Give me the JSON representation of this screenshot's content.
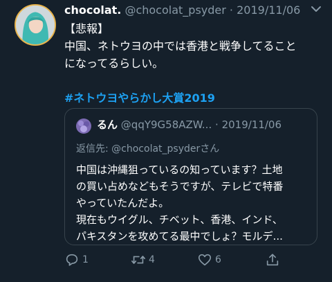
{
  "tweet": {
    "display_name": "chocolat.",
    "handle": "@chocolat_psyder",
    "separator": "·",
    "date": "2019/11/06",
    "lines": [
      "【悲報】",
      "中国、ネトウヨの中では香港と戦争してること",
      "になってるらしい。"
    ],
    "hashtag": "#ネトウヨやらかし大賞2019"
  },
  "quote": {
    "display_name": "るん",
    "handle": "@qqY9G58AZW...",
    "separator": "·",
    "date": "2019/11/06",
    "reply_prefix": "返信先: ",
    "reply_handle": "@chocolat_psyder",
    "reply_suffix": "さん",
    "lines": [
      "中国は沖縄狙っているの知っています？土地",
      "の買い占めなどもそうですが、テレビで特番",
      "やっていたんだよ。",
      "現在もウイグル、チベット、香港、インド、",
      "パキスタンを攻めてる最中でしょ？モルデ..."
    ]
  },
  "actions": {
    "reply_count": "1",
    "retweet_count": "4",
    "like_count": "6"
  },
  "icons": [
    "caret-down-icon",
    "reply-icon",
    "retweet-icon",
    "like-icon",
    "share-icon"
  ],
  "colors": {
    "background": "#15202b",
    "text": "#ffffff",
    "secondary": "#8899a6",
    "link": "#1da1f2",
    "border": "#38444d"
  }
}
